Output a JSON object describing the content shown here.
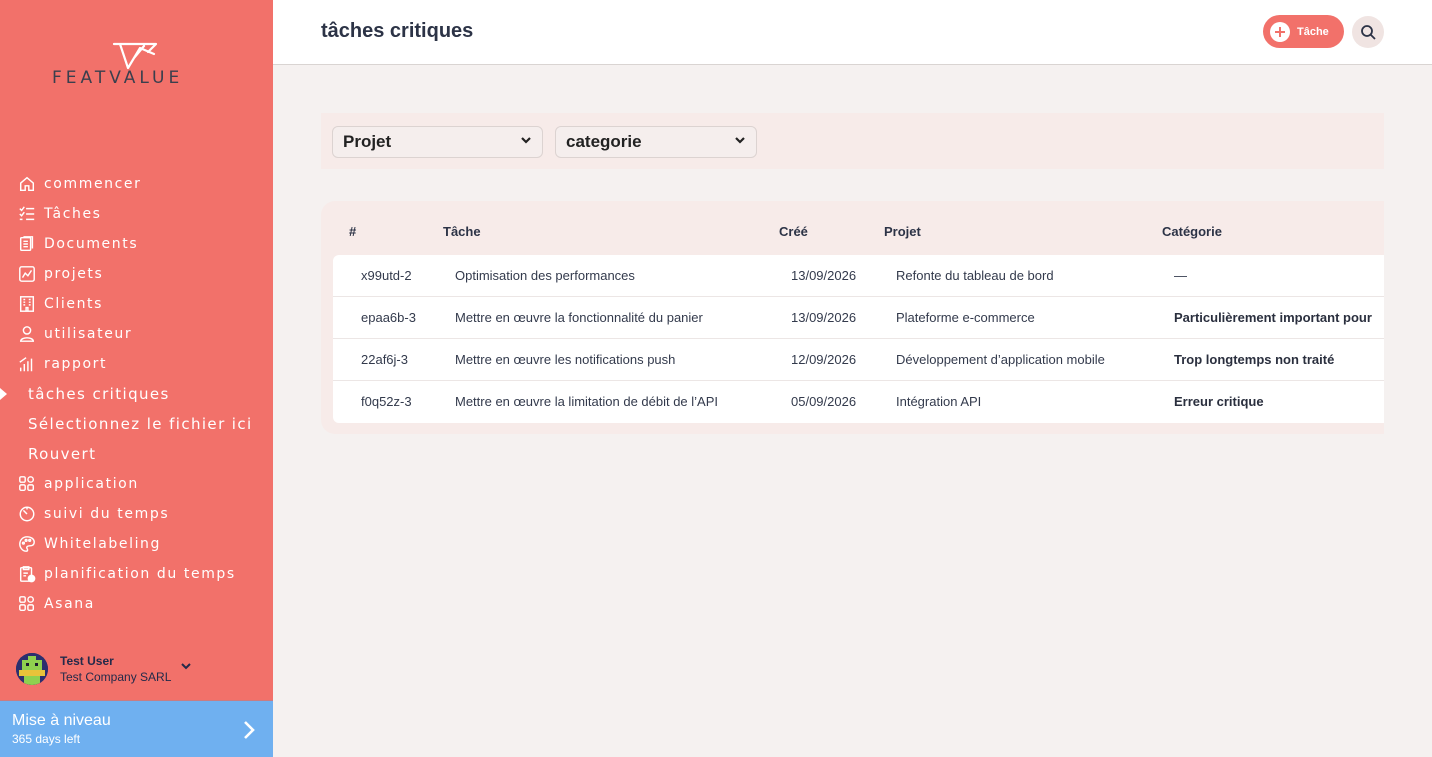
{
  "brand": {
    "name": "FEATVALUE"
  },
  "sidebar": {
    "items": [
      {
        "label": "commencer",
        "icon": "home-icon"
      },
      {
        "label": "Tâches",
        "icon": "checklist-icon"
      },
      {
        "label": "Documents",
        "icon": "documents-icon"
      },
      {
        "label": "projets",
        "icon": "chart-icon"
      },
      {
        "label": "Clients",
        "icon": "building-icon"
      },
      {
        "label": "utilisateur",
        "icon": "user-icon"
      },
      {
        "label": "rapport",
        "icon": "bar-chart-icon"
      },
      {
        "label": "tâches critiques",
        "sub": true,
        "active": true
      },
      {
        "label": "Sélectionnez le fichier ici",
        "sub": true
      },
      {
        "label": "Rouvert",
        "sub": true
      },
      {
        "label": "application",
        "icon": "apps-icon"
      },
      {
        "label": "suivi du temps",
        "icon": "timer-icon"
      },
      {
        "label": "Whitelabeling",
        "icon": "palette-icon"
      },
      {
        "label": "planification du temps",
        "icon": "clipboard-clock-icon"
      },
      {
        "label": "Asana",
        "icon": "apps-icon"
      }
    ],
    "user": {
      "name": "Test User",
      "company": "Test Company SARL"
    },
    "upgrade": {
      "title": "Mise à niveau",
      "subtitle": "365 days left"
    }
  },
  "header": {
    "title": "tâches critiques",
    "task_button": "Tâche"
  },
  "filters": {
    "project": "Projet",
    "category": "categorie"
  },
  "table": {
    "headers": {
      "id": "#",
      "task": "Tâche",
      "created": "Créé",
      "project": "Projet",
      "category": "Catégorie"
    },
    "rows": [
      {
        "id": "x99utd-2",
        "task": "Optimisation des performances",
        "created": "13/09/2026",
        "project": "Refonte du tableau de bord",
        "category": "—"
      },
      {
        "id": "epaa6b-3",
        "task": "Mettre en œuvre la fonctionnalité du panier",
        "created": "13/09/2026",
        "project": "Plateforme e-commerce",
        "category": "Particulièrement important pour"
      },
      {
        "id": "22af6j-3",
        "task": "Mettre en œuvre les notifications push",
        "created": "12/09/2026",
        "project": "Développement d’application mobile",
        "category": "Trop longtemps non traité"
      },
      {
        "id": "f0q52z-3",
        "task": "Mettre en œuvre la limitation de débit de l’API",
        "created": "05/09/2026",
        "project": "Intégration API",
        "category": "Erreur critique"
      }
    ]
  },
  "colors": {
    "sidebar": "#f2716a",
    "upgrade": "#6fb0f0",
    "accent": "#f2716a"
  }
}
